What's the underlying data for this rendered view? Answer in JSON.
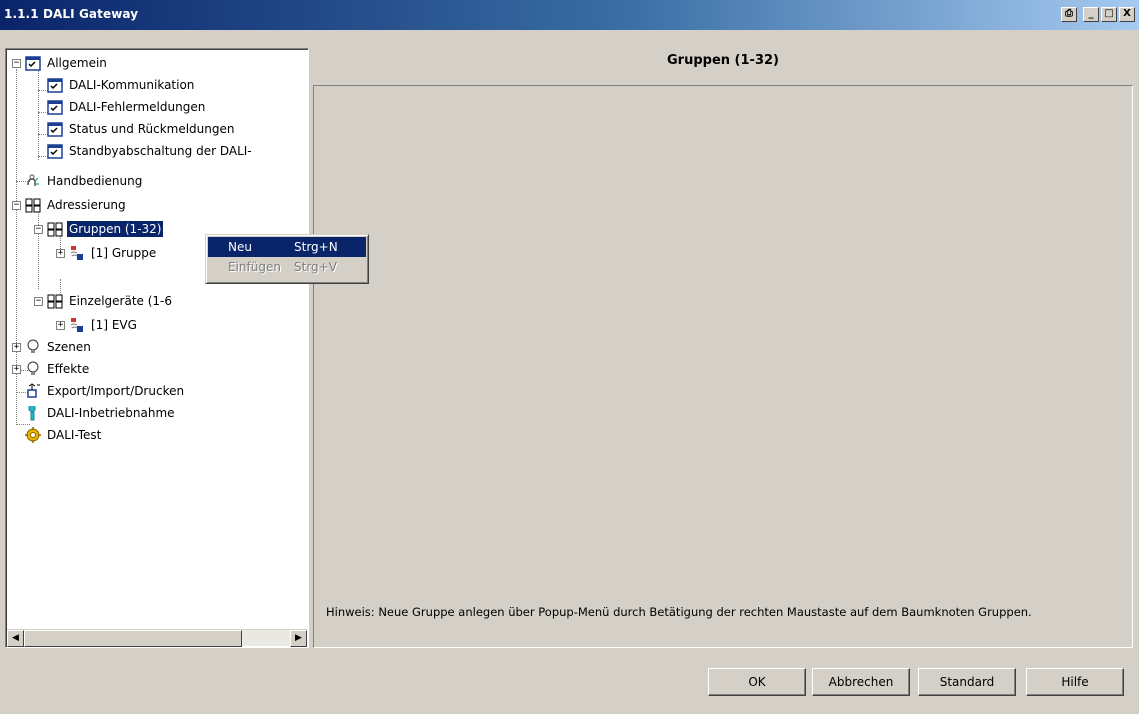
{
  "window": {
    "title": "1.1.1 DALI Gateway",
    "buttons": {
      "print": "⎙",
      "minimize": "_",
      "maximize": "□",
      "close": "X"
    }
  },
  "tree": {
    "items": [
      {
        "label": "Allgemein",
        "icon": "checklist-icon"
      },
      {
        "label": "DALI-Kommunikation",
        "icon": "checklist-icon"
      },
      {
        "label": "DALI-Fehlermeldungen",
        "icon": "checklist-icon"
      },
      {
        "label": "Status und Rückmeldungen",
        "icon": "checklist-icon"
      },
      {
        "label": "Standbyabschaltung der DALI-",
        "icon": "checklist-icon"
      },
      {
        "label": "Handbedienung",
        "icon": "hand-operation-icon"
      },
      {
        "label": "Adressierung",
        "icon": "grid-icon"
      },
      {
        "label": "Gruppen (1-32)",
        "icon": "grid-icon",
        "selected": true
      },
      {
        "label": "[1] Gruppe",
        "icon": "device-group-icon"
      },
      {
        "label": "Einzelgeräte (1-6",
        "icon": "grid-icon"
      },
      {
        "label": "[1] EVG",
        "icon": "device-group-icon"
      },
      {
        "label": "Szenen",
        "icon": "lightbulb-icon"
      },
      {
        "label": "Effekte",
        "icon": "lightbulb-icon"
      },
      {
        "label": "Export/Import/Drucken",
        "icon": "export-icon"
      },
      {
        "label": "DALI-Inbetriebnahme",
        "icon": "wrench-icon"
      },
      {
        "label": "DALI-Test",
        "icon": "gear-icon"
      }
    ]
  },
  "context_menu": {
    "items": [
      {
        "label": "Neu",
        "shortcut": "Strg+N",
        "highlighted": true,
        "disabled": false
      },
      {
        "label": "Einfügen",
        "shortcut": "Strg+V",
        "highlighted": false,
        "disabled": true
      }
    ]
  },
  "panel": {
    "title": "Gruppen (1-32)",
    "hint": "Hinweis: Neue Gruppe anlegen über Popup-Menü durch Betätigung der rechten  Maustaste auf dem Baumknoten Gruppen."
  },
  "footer": {
    "ok": "OK",
    "cancel": "Abbrechen",
    "standard": "Standard",
    "help": "Hilfe"
  },
  "colors": {
    "selection": "#0a246a",
    "window_bg": "#d4d0c8"
  }
}
